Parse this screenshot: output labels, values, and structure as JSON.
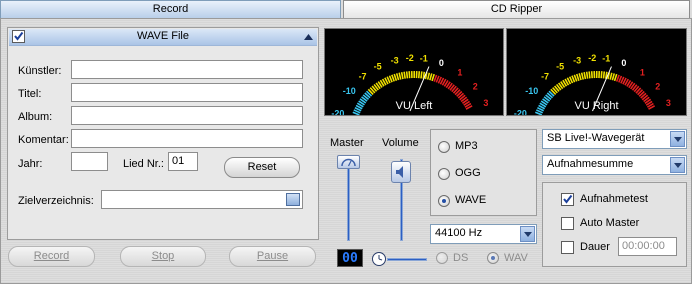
{
  "tabs": [
    {
      "label": "Record",
      "active": true
    },
    {
      "label": "CD Ripper",
      "active": false
    }
  ],
  "wave_panel": {
    "title": "WAVE File",
    "checked": true,
    "fields": {
      "artist_label": "Künstler:",
      "artist_value": "",
      "title_label": "Titel:",
      "title_value": "",
      "album_label": "Album:",
      "album_value": "",
      "comment_label": "Komentar:",
      "comment_value": "",
      "year_label": "Jahr:",
      "year_value": "",
      "track_label": "Lied Nr.:",
      "track_value": "01",
      "target_dir_label": "Zielverzeichnis:",
      "target_dir_value": ""
    },
    "reset_label": "Reset"
  },
  "transport": {
    "record_label": "Record",
    "stop_label": "Stop",
    "pause_label": "Pause"
  },
  "vu_meters": {
    "scale": [
      "-20",
      "-10",
      "-7",
      "-5",
      "-3",
      "-2",
      "-1",
      "0",
      "1",
      "2",
      "3"
    ],
    "left_label": "VU Left",
    "right_label": "VU Right",
    "colors": {
      "cold": "#39c6f0",
      "warm": "#f0e000",
      "hot": "#e32020"
    }
  },
  "mixer": {
    "master_label": "Master",
    "volume_label": "Volume",
    "level_display": "00",
    "master_level": 1.0,
    "volume_level": 0.95
  },
  "format": {
    "options": [
      "MP3",
      "OGG",
      "WAVE"
    ],
    "selected": "WAVE",
    "sample_rate": "44100 Hz"
  },
  "timer": {
    "options": [
      "DS",
      "WAV"
    ],
    "selected": "WAV"
  },
  "device": {
    "soundcard": "SB Live!-Wavegerät",
    "input": "Aufnahmesumme"
  },
  "options": {
    "test_label": "Aufnahmetest",
    "test_checked": true,
    "automaster_label": "Auto Master",
    "automaster_checked": false,
    "duration_label": "Dauer",
    "duration_checked": false,
    "duration_value": "00:00:00"
  }
}
